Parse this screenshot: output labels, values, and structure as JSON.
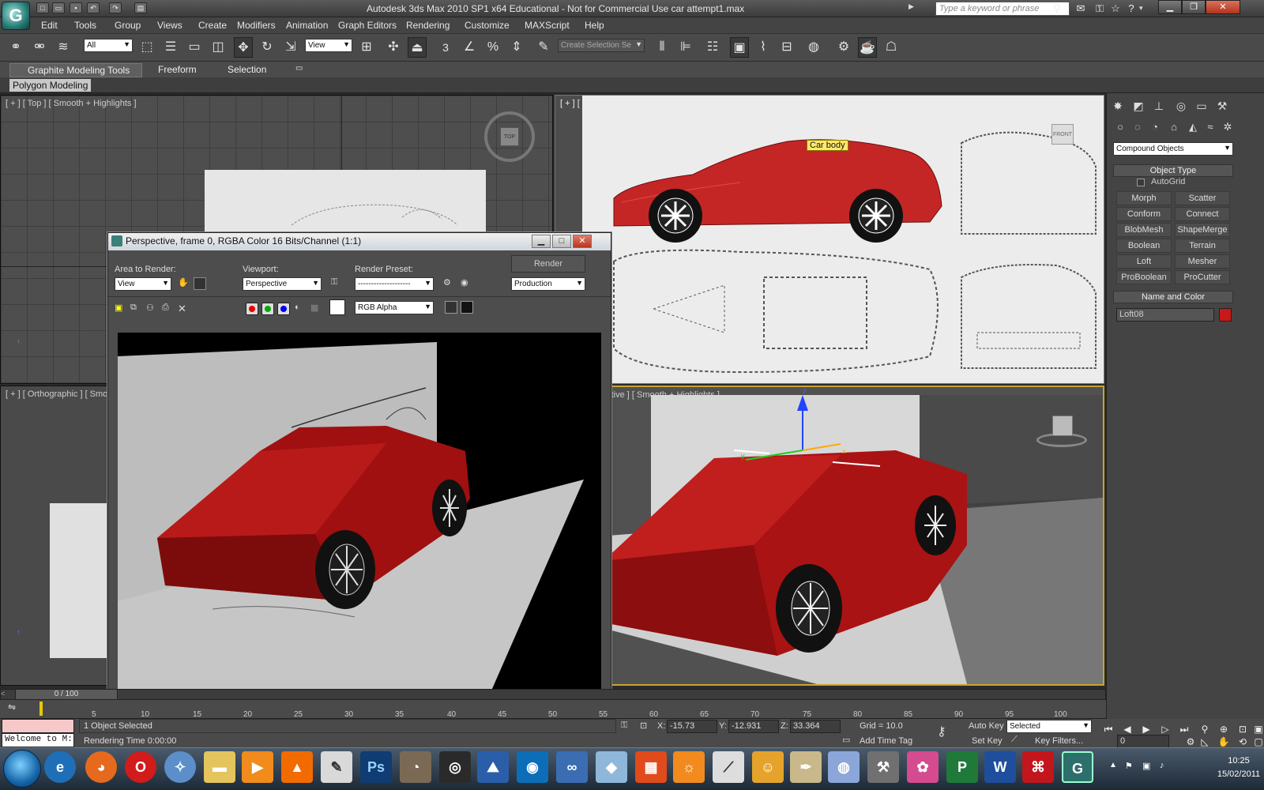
{
  "titlebar": {
    "title": "Autodesk 3ds Max  2010 SP1 x64   Educational - Not for Commercial Use       car attempt1.max",
    "search_placeholder": "Type a keyword or phrase"
  },
  "menu": [
    "Edit",
    "Tools",
    "Group",
    "Views",
    "Create",
    "Modifiers",
    "Animation",
    "Graph Editors",
    "Rendering",
    "Customize",
    "MAXScript",
    "Help"
  ],
  "toolbar": {
    "selection_filter": "All",
    "ref_coord": "View",
    "snap_value": "3",
    "named_selection_placeholder": "Create Selection Se"
  },
  "ribbon": {
    "tabs": [
      "Graphite Modeling Tools",
      "Freeform",
      "Selection"
    ],
    "panel_tab": "Polygon Modeling"
  },
  "viewports": {
    "top": "[ + ] [ Top ] [ Smooth + Highlights ]",
    "front": "[ + ] [ Front ] [ Smooth + Highlights ]",
    "ortho": "[ + ] [ Orthographic ] [ Smoo",
    "persp": "ective ] [ Smooth + Highlights ]",
    "tooltip": "Car body",
    "viewcube_top": "TOP",
    "viewcube_front": "FRONT",
    "gizmo_x": "x",
    "gizmo_y": "y",
    "gizmo_z": "z"
  },
  "render_window": {
    "title": "Perspective, frame 0, RGBA Color 16 Bits/Channel (1:1)",
    "area_label": "Area to Render:",
    "area_value": "View",
    "viewport_label": "Viewport:",
    "viewport_value": "Perspective",
    "preset_label": "Render Preset:",
    "preset_value": "--------------------",
    "render_button": "Render",
    "production_value": "Production",
    "channel_value": "RGB Alpha"
  },
  "command_panel": {
    "category": "Compound Objects",
    "object_type_header": "Object Type",
    "autogrid": "AutoGrid",
    "buttons": [
      "Morph",
      "Scatter",
      "Conform",
      "Connect",
      "BlobMesh",
      "ShapeMerge",
      "Boolean",
      "Terrain",
      "Loft",
      "Mesher",
      "ProBoolean",
      "ProCutter"
    ],
    "name_color_header": "Name and Color",
    "object_name": "Loft08",
    "object_color": "#c81818"
  },
  "timeline": {
    "frame_counter": "0 / 100",
    "ticks": [
      "5",
      "10",
      "15",
      "20",
      "25",
      "30",
      "35",
      "40",
      "45",
      "50",
      "55",
      "60",
      "65",
      "70",
      "75",
      "80",
      "85",
      "90",
      "95",
      "100"
    ]
  },
  "status": {
    "listener": "Welcome to M:",
    "selected_text": "1 Object Selected",
    "render_time": "Rendering Time  0:00:00",
    "x_label": "X:",
    "x_value": "-15.73",
    "y_label": "Y:",
    "y_value": "-12.931",
    "z_label": "Z:",
    "z_value": "33.364",
    "grid": "Grid = 10.0",
    "add_time_tag": "Add Time Tag",
    "auto_key": "Auto Key",
    "set_key": "Set Key",
    "key_mode": "Selected",
    "key_filters": "Key Filters...",
    "current_frame": "0"
  },
  "taskbar": {
    "time": "10:25",
    "date": "15/02/2011",
    "apps": [
      "ie-icon",
      "firefox-icon",
      "opera-icon",
      "safari-icon",
      "folder-icon",
      "media-player-icon",
      "vlc-icon",
      "paint-icon",
      "photoshop-icon",
      "gimp-icon",
      "app-icon",
      "matlab-icon",
      "app2-icon",
      "infinity-icon",
      "box-icon",
      "office-icon",
      "sed-icon",
      "chart-icon",
      "pen-icon",
      "cat-icon",
      "pen2-icon",
      "globe-icon",
      "tools-icon",
      "swirl-icon",
      "publisher-icon",
      "word-icon",
      "acrobat-icon",
      "max-icon"
    ],
    "app_letters": {
      "photoshop": "Ps",
      "word": "W",
      "publisher": "P"
    }
  },
  "colors": {
    "car_red": "#b01515",
    "viewport_active_border": "#c8a430"
  }
}
